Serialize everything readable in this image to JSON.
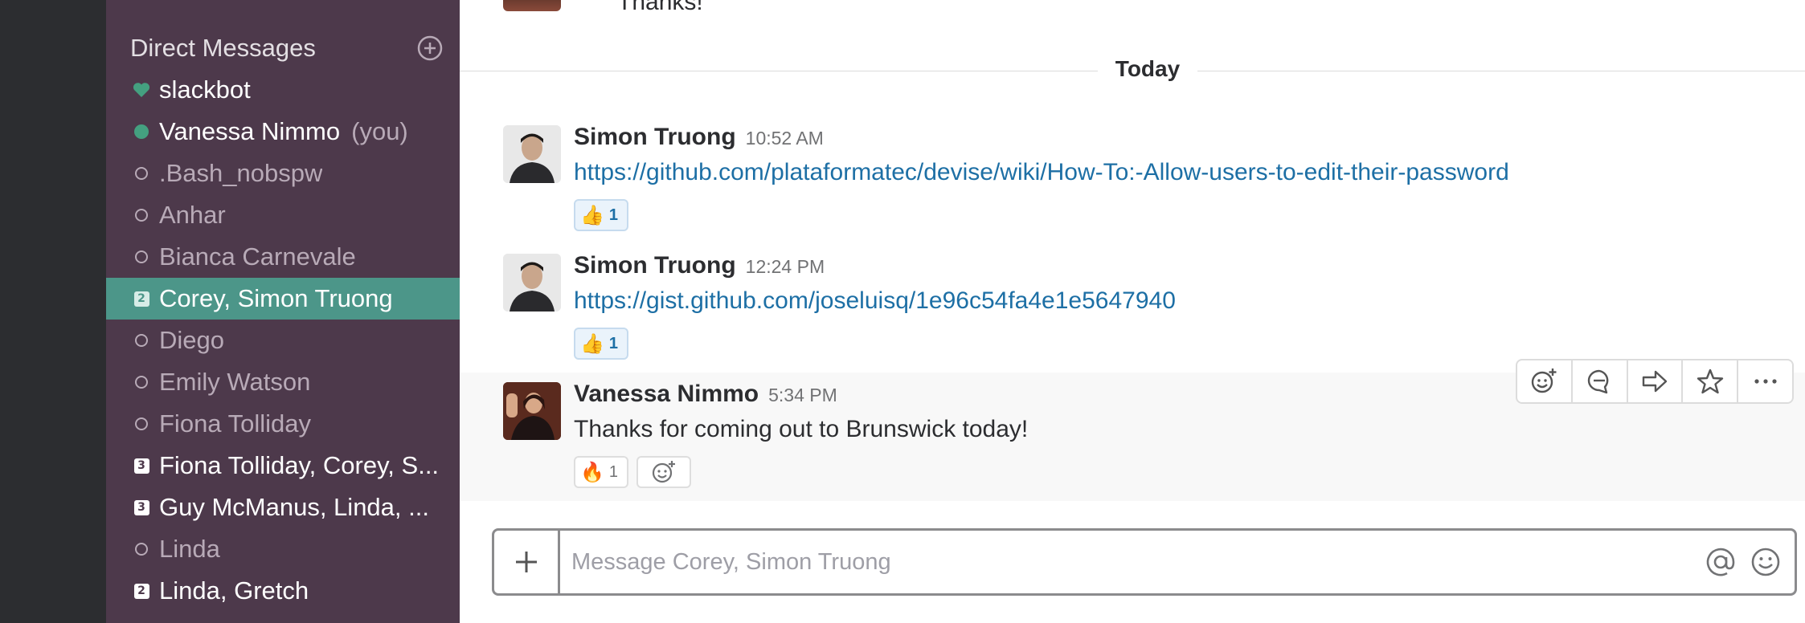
{
  "sidebar": {
    "dm_title": "Direct Messages",
    "items": [
      {
        "label": "slackbot",
        "status": "heart",
        "you": ""
      },
      {
        "label": "Vanessa Nimmo",
        "status": "online",
        "you": "(you)"
      },
      {
        "label": ".Bash_nobspw",
        "status": "away",
        "you": ""
      },
      {
        "label": "Anhar",
        "status": "away",
        "you": ""
      },
      {
        "label": "Bianca Carnevale",
        "status": "away",
        "you": ""
      },
      {
        "label": "Corey, Simon Truong",
        "status": "group",
        "count": "2",
        "you": ""
      },
      {
        "label": "Diego",
        "status": "away",
        "you": ""
      },
      {
        "label": "Emily Watson",
        "status": "away",
        "you": ""
      },
      {
        "label": "Fiona Tolliday",
        "status": "away",
        "you": ""
      },
      {
        "label": "Fiona Tolliday, Corey, S...",
        "status": "group",
        "count": "3",
        "you": ""
      },
      {
        "label": "Guy McManus, Linda, ...",
        "status": "group",
        "count": "3",
        "you": ""
      },
      {
        "label": "Linda",
        "status": "away",
        "you": ""
      },
      {
        "label": "Linda, Gretch",
        "status": "group",
        "count": "2",
        "you": ""
      }
    ]
  },
  "main": {
    "previous_message_text": "Thanks!",
    "day_divider": "Today",
    "messages": [
      {
        "sender": "Simon Truong",
        "time": "10:52 AM",
        "text": "https://github.com/plataformatec/devise/wiki/How-To:-Allow-users-to-edit-their-password",
        "reaction_emoji": "👍",
        "reaction_count": "1"
      },
      {
        "sender": "Simon Truong",
        "time": "12:24 PM",
        "text": "https://gist.github.com/joseluisq/1e96c54fa4e1e5647940",
        "reaction_emoji": "👍",
        "reaction_count": "1"
      },
      {
        "sender": "Vanessa Nimmo",
        "time": "5:34 PM",
        "text": "Thanks for coming out to Brunswick today!",
        "reaction_emoji": "🔥",
        "reaction_count": "1"
      }
    ],
    "message_actions": [
      "add-reaction-icon",
      "start-thread-icon",
      "share-message-icon",
      "star-icon",
      "more-actions-icon"
    ]
  },
  "composer": {
    "placeholder": "Message Corey, Simon Truong"
  },
  "colors": {
    "sidebar_bg": "#4d394b",
    "active_item_bg": "#4c9689",
    "team_rail_bg": "#2c2d30",
    "link": "#1d6fa5",
    "online": "#44a080"
  }
}
